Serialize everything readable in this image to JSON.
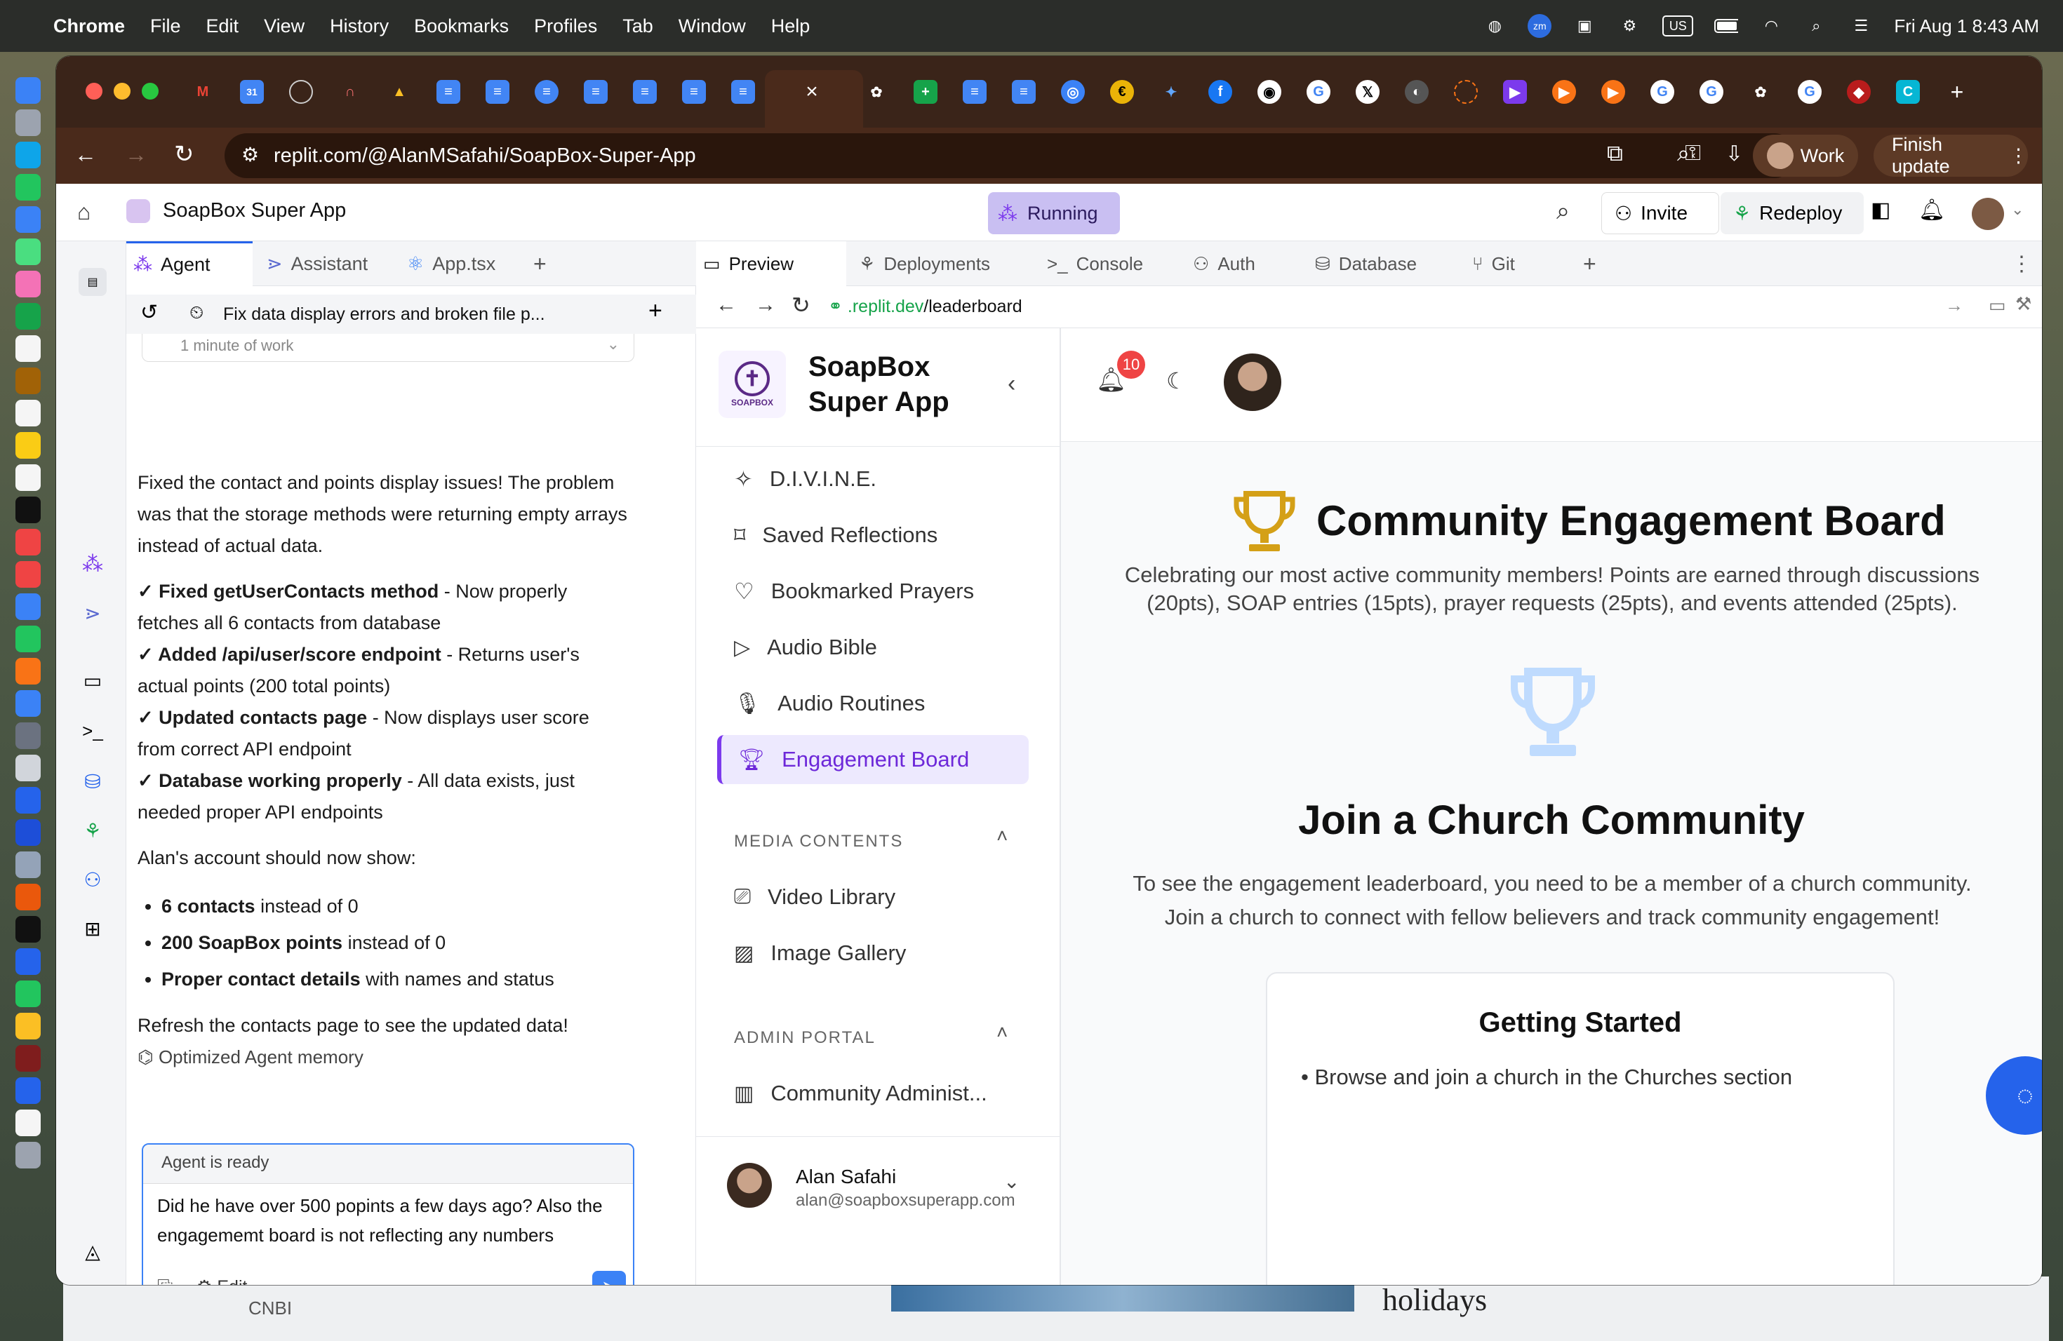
{
  "menubar": {
    "apple": "",
    "app": "Chrome",
    "items": [
      "File",
      "Edit",
      "View",
      "History",
      "Bookmarks",
      "Profiles",
      "Tab",
      "Window",
      "Help"
    ],
    "input_label": "US",
    "datetime": "Fri Aug 1  8:43 AM"
  },
  "browser": {
    "url": "replit.com/@AlanMSafahi/SoapBox-Super-App",
    "work_label": "Work",
    "finish_label": "Finish update"
  },
  "replit": {
    "app_name": "SoapBox Super App",
    "status": "Running",
    "invite": "Invite",
    "redeploy": "Redeploy"
  },
  "agent_panel": {
    "tabs": [
      "Agent",
      "Assistant",
      "App.tsx"
    ],
    "thread_title": "Fix data display errors and broken file p...",
    "work_time": "1 minute of work",
    "message": {
      "intro": "Fixed the contact and points display issues! The problem was that the storage methods were returning empty arrays instead of actual data.",
      "fixes": [
        {
          "title": "✓ Fixed getUserContacts method",
          "rest": " - Now properly fetches all 6 contacts from database"
        },
        {
          "title": "✓ Added /api/user/score endpoint",
          "rest": " - Returns user's actual points (200 total points)"
        },
        {
          "title": "✓ Updated contacts page",
          "rest": " - Now displays user score from correct API endpoint"
        },
        {
          "title": "✓ Database working properly",
          "rest": " - All data exists, just needed proper API endpoints"
        }
      ],
      "account_intro": "Alan's account should now show:",
      "bullets": [
        {
          "bold": "6 contacts",
          "rest": " instead of 0"
        },
        {
          "bold": "200 SoapBox points",
          "rest": " instead of 0"
        },
        {
          "bold": "Proper contact details",
          "rest": " with names and status"
        }
      ],
      "outro": "Refresh the contacts page to see the updated data!",
      "memory": "Optimized Agent memory"
    },
    "status": "Agent is ready",
    "input_value": "Did he have over 500 popints a few days ago? Also the engagememt board is not reflecting any numbers",
    "edit_label": "Edit"
  },
  "preview": {
    "tabs": [
      "Preview",
      "Deployments",
      "Console",
      "Auth",
      "Database",
      "Git"
    ],
    "url_prefix": ".replit.dev",
    "url_path": "/leaderboard",
    "app": {
      "brand": "SoapBox Super App",
      "logo_text": "SOAPBOX",
      "nav": [
        "D.I.V.I.N.E.",
        "Saved Reflections",
        "Bookmarked Prayers",
        "Audio Bible",
        "Audio Routines",
        "Engagement Board"
      ],
      "media_header": "MEDIA CONTENTS",
      "media": [
        "Video Library",
        "Image Gallery"
      ],
      "admin_header": "ADMIN PORTAL",
      "admin": [
        "Community Administ..."
      ],
      "user_name": "Alan Safahi",
      "user_email": "alan@soapboxsuperapp.com",
      "notifications": "10",
      "title": "Community Engagement Board",
      "subtitle": "Celebrating our most active community members! Points are earned through discussions (20pts), SOAP entries (15pts), prayer requests (25pts), and events attended (25pts).",
      "join_title": "Join a Church Community",
      "join_text": "To see the engagement leaderboard, you need to be a member of a church community. Join a church to connect with fellow believers and track community engagement!",
      "getting_started": "Getting Started",
      "steps": [
        "• Browse and join a church in the Churches section"
      ]
    }
  },
  "background": {
    "headline": "holidays",
    "caption": "CNBI"
  },
  "colors": {
    "accent": "#7c3aed",
    "blue": "#3b82f6",
    "gold": "#d4a017",
    "tab_bg": "#3a2419"
  }
}
